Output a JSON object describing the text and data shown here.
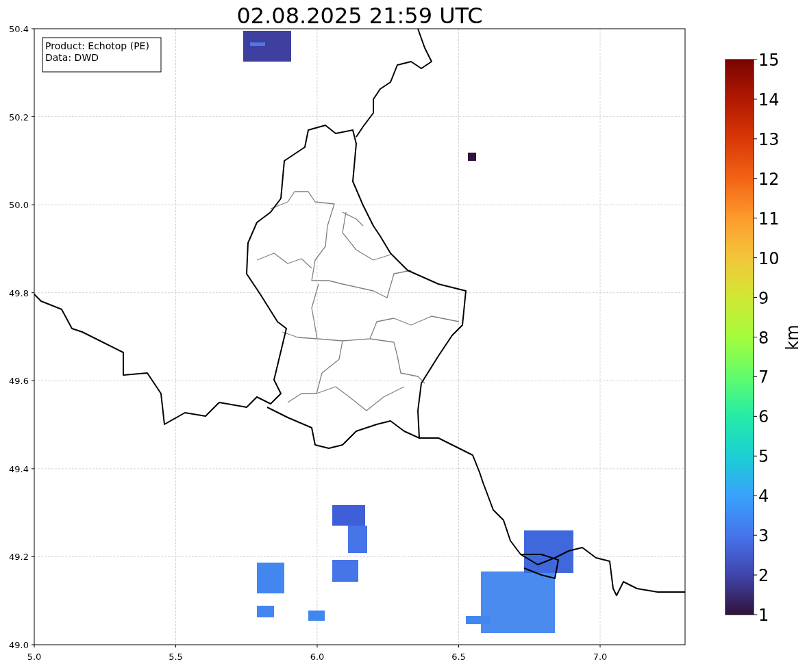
{
  "title": "02.08.2025 21:59 UTC",
  "info_box": [
    "Product: Echotop (PE)",
    "Data: DWD"
  ],
  "x_axis": {
    "ticks": [
      "5.0",
      "5.5",
      "6.0",
      "6.5",
      "7.0"
    ]
  },
  "y_axis": {
    "ticks": [
      "50.4",
      "50.2",
      "50.0",
      "49.8",
      "49.6",
      "49.4",
      "49.2",
      "49.0"
    ]
  },
  "colorbar": {
    "label": "km",
    "ticks": [
      "15",
      "14",
      "13",
      "12",
      "11",
      "10",
      "9",
      "8",
      "7",
      "6",
      "5",
      "4",
      "3",
      "2",
      "1"
    ]
  }
}
